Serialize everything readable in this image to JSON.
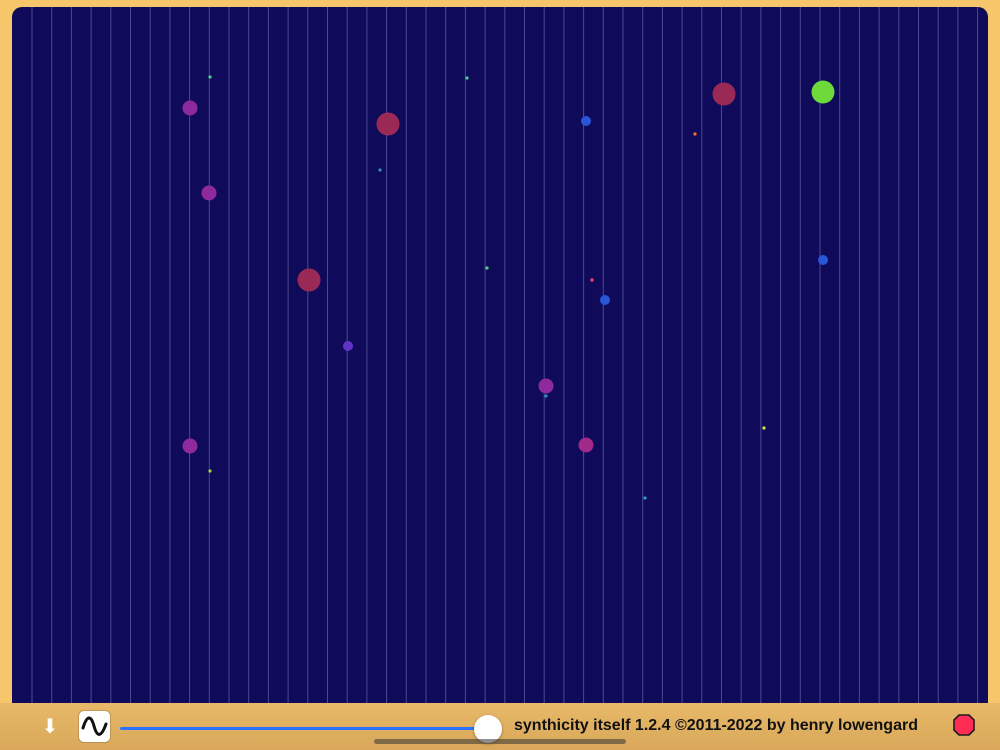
{
  "app": {
    "title": "synthicity itself 1.2.4  ©2011-2022 by henry lowengard"
  },
  "colors": {
    "frame": "#f7c66a",
    "canvas": "#0f0b5a",
    "gridline": "#4b4a8e"
  },
  "toolbar": {
    "down_icon": "arrow-down-icon",
    "waveform_icon": "sine-wave-icon",
    "stop_icon": "stop-octagon-icon",
    "slider_level": 0.99
  },
  "grid": {
    "vertical_lines": 49
  },
  "particles": [
    {
      "color": "#8f2a9e",
      "size": "medium"
    },
    {
      "color": "#8f2a9e",
      "size": "medium"
    },
    {
      "color": "#9a2a55",
      "size": "large"
    },
    {
      "color": "#9a2a55",
      "size": "large"
    },
    {
      "color": "#9a2a55",
      "size": "large"
    },
    {
      "color": "#6dd93b",
      "size": "large"
    },
    {
      "color": "#2a56d6",
      "size": "small"
    },
    {
      "color": "#2a56d6",
      "size": "small"
    },
    {
      "color": "#2a56d6",
      "size": "small"
    },
    {
      "color": "#6233c7",
      "size": "small"
    },
    {
      "color": "#8f2a9e",
      "size": "medium"
    },
    {
      "color": "#8f2a9e",
      "size": "medium"
    },
    {
      "color": "#9f2a8a",
      "size": "medium"
    },
    {
      "color": "#2a8ec8",
      "size": "tiny"
    },
    {
      "color": "#2a8ec8",
      "size": "tiny"
    },
    {
      "color": "#26a0c3",
      "size": "tiny"
    },
    {
      "color": "#9fd43a",
      "size": "tiny"
    },
    {
      "color": "#47d18b",
      "size": "tiny"
    },
    {
      "color": "#47d18b",
      "size": "tiny"
    },
    {
      "color": "#47d18b",
      "size": "tiny"
    },
    {
      "color": "#ff6a2f",
      "size": "tiny"
    },
    {
      "color": "#ff4a5e",
      "size": "tiny"
    },
    {
      "color": "#d6e04a",
      "size": "tiny"
    }
  ]
}
